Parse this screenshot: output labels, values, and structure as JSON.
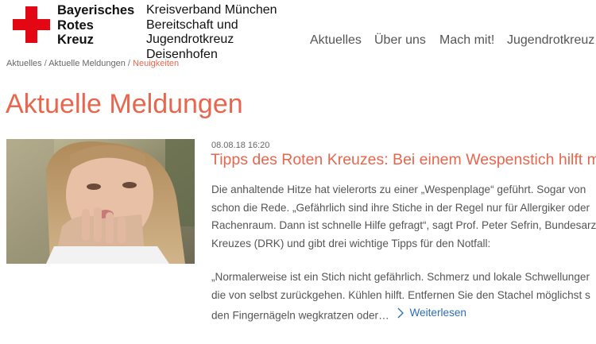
{
  "brand": {
    "line1": "Bayerisches",
    "line2": "Rotes",
    "line3": "Kreuz"
  },
  "org": {
    "line1": "Kreisverband München",
    "line2": "Bereitschaft und",
    "line3": "Jugendrotkreuz",
    "line4": "Deisenhofen"
  },
  "nav": {
    "items": [
      "Aktuelles",
      "Über uns",
      "Mach mit!",
      "Jugendrotkreuz"
    ]
  },
  "breadcrumb": {
    "item1": "Aktuelles",
    "item2": "Aktuelle Meldungen",
    "current": "Neuigkeiten",
    "separator": "/"
  },
  "page": {
    "title": "Aktuelle Meldungen"
  },
  "article": {
    "date": "08.08.18 16:20",
    "title": "Tipps des Roten Kreuzes: Bei einem Wespenstich hilft m",
    "para1": [
      "Die anhaltende Hitze hat vielerorts zu einer „Wespenplage“ geführt. Sogar von",
      "schon die Rede. „Gefährlich sind ihre Stiche in der Regel nur für Allergiker oder",
      "Rachenraum. Dann ist schnelle Hilfe gefragt“, sagt Prof. Peter Sefrin, Bundesarz",
      "Kreuzes (DRK) und gibt drei wichtige Tipps für den Notfall:"
    ],
    "para2": [
      "„Normalerweise ist ein Stich nicht gefährlich. Schmerz und lokale Schwellunger",
      "die von selbst zurückgehen. Kühlen hilft. Entfernen Sie den Stachel möglichst s",
      "den Fingernägeln wegkratzen oder…"
    ],
    "read_more": "Weiterlesen"
  },
  "colors": {
    "red": "#e30613",
    "accent": "#e8664d",
    "link": "#2b6cb5",
    "text": "#555555"
  },
  "icons": {
    "logo": "red-cross-icon",
    "read_more": "chevron-right-icon"
  }
}
